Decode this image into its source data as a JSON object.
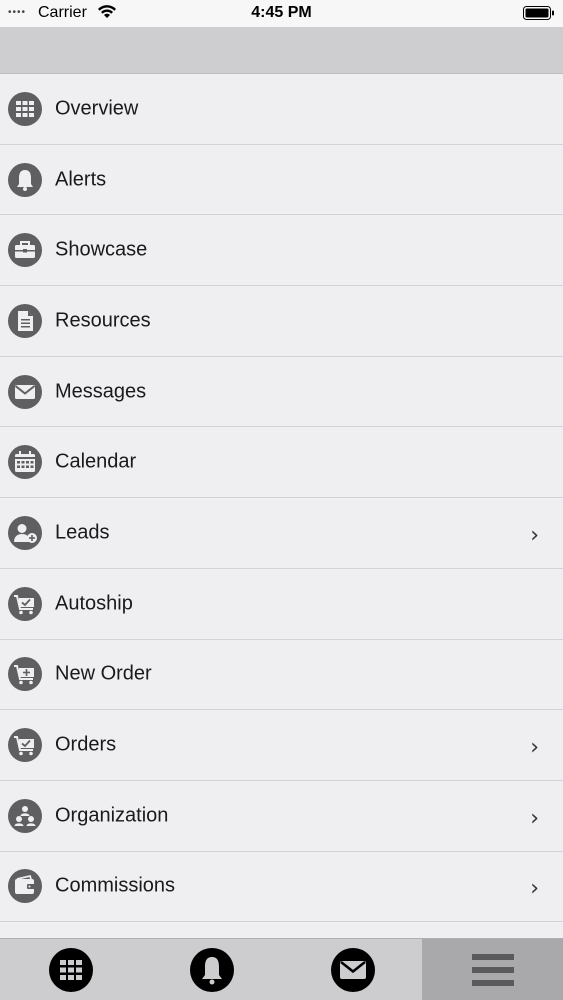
{
  "status_bar": {
    "signal": "••••",
    "carrier": "Carrier",
    "time": "4:45 PM"
  },
  "menu": {
    "items": [
      {
        "label": "Overview",
        "icon": "grid-icon",
        "chevron": false
      },
      {
        "label": "Alerts",
        "icon": "bell-icon",
        "chevron": false
      },
      {
        "label": "Showcase",
        "icon": "briefcase-icon",
        "chevron": false
      },
      {
        "label": "Resources",
        "icon": "document-icon",
        "chevron": false
      },
      {
        "label": "Messages",
        "icon": "envelope-icon",
        "chevron": false
      },
      {
        "label": "Calendar",
        "icon": "calendar-icon",
        "chevron": false
      },
      {
        "label": "Leads",
        "icon": "add-user-icon",
        "chevron": true
      },
      {
        "label": "Autoship",
        "icon": "cart-check-icon",
        "chevron": false
      },
      {
        "label": "New Order",
        "icon": "cart-plus-icon",
        "chevron": false
      },
      {
        "label": "Orders",
        "icon": "cart-check-icon",
        "chevron": true
      },
      {
        "label": "Organization",
        "icon": "organization-icon",
        "chevron": true
      },
      {
        "label": "Commissions",
        "icon": "wallet-icon",
        "chevron": true
      }
    ],
    "chevron_glyph": "›"
  },
  "tab_bar": {
    "tabs": [
      {
        "icon": "grid-icon",
        "active": false
      },
      {
        "icon": "bell-icon",
        "active": false
      },
      {
        "icon": "envelope-icon",
        "active": false
      },
      {
        "icon": "hamburger-menu-icon",
        "active": true
      }
    ]
  },
  "colors": {
    "background": "#efeef1",
    "header": "#cecdd0",
    "icon": "#5f5f62",
    "tab_bar": "#cdcccf",
    "tab_active": "#a9a8ab"
  }
}
